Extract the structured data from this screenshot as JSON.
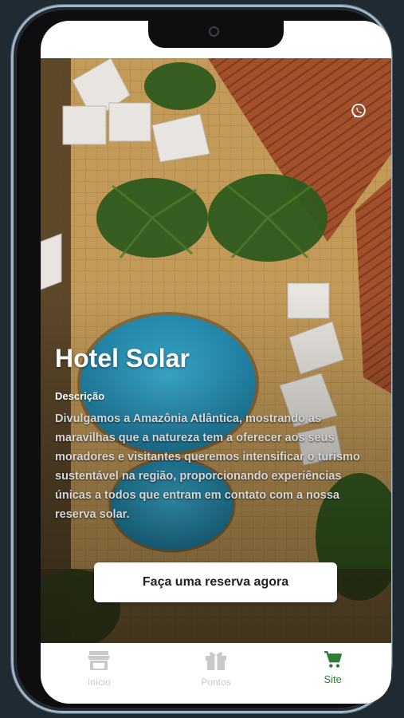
{
  "hero": {
    "title": "Hotel Solar",
    "description_label": "Descrição",
    "description": "Divulgamos a Amazônia Atlântica, mostrando as maravilhas que a natureza tem a oferecer aos seus moradores e visitantes queremos intensificar o turismo sustentável na região, proporcionando experiências únicas a todos que entram em contato com a nossa reserva solar.",
    "cta_label": "Faça uma reserva agora",
    "contact_icon": "whatsapp-icon"
  },
  "bottom_nav": {
    "items": [
      {
        "label": "Início",
        "icon": "store-icon",
        "active": false
      },
      {
        "label": "Pontos",
        "icon": "gift-icon",
        "active": false
      },
      {
        "label": "Site",
        "icon": "cart-icon",
        "active": true
      }
    ]
  },
  "colors": {
    "accent": "#2e7d32",
    "inactive": "#c9c9c9",
    "pool": "#2aa3c9",
    "roof": "#a8502a",
    "sand": "#c59a55"
  }
}
